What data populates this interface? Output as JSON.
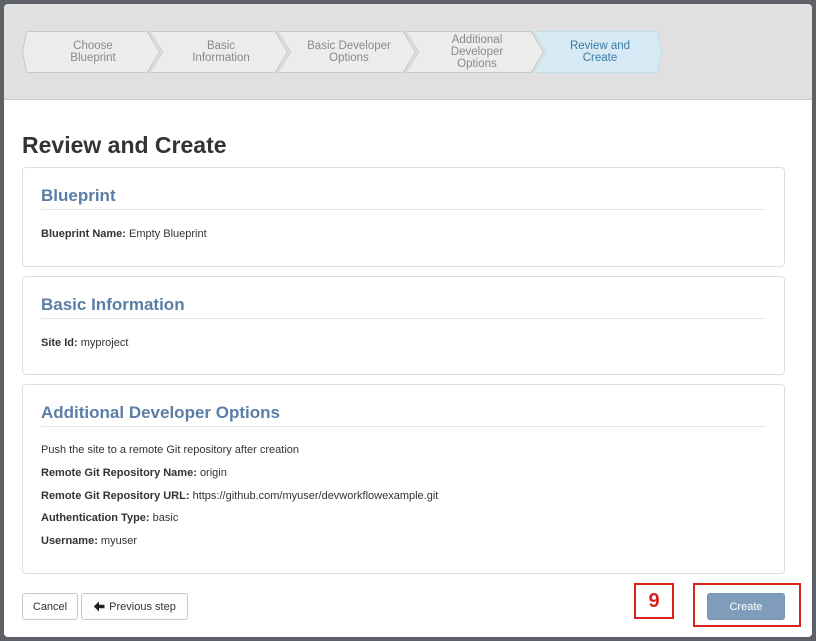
{
  "wizard": {
    "steps": [
      {
        "line1": "Choose",
        "line2": "Blueprint",
        "line3": ""
      },
      {
        "line1": "Basic",
        "line2": "Information",
        "line3": ""
      },
      {
        "line1": "Basic Developer",
        "line2": "Options",
        "line3": ""
      },
      {
        "line1": "Additional",
        "line2": "Developer",
        "line3": "Options"
      },
      {
        "line1": "Review and",
        "line2": "Create",
        "line3": ""
      }
    ],
    "active_step": 4
  },
  "page": {
    "title": "Review and Create"
  },
  "blueprint": {
    "title": "Blueprint",
    "name_label": "Blueprint Name:",
    "name_value": "Empty Blueprint"
  },
  "basic_info": {
    "title": "Basic Information",
    "site_id_label": "Site Id:",
    "site_id_value": "myproject"
  },
  "additional": {
    "title": "Additional Developer Options",
    "push_text": "Push the site to a remote Git repository after creation",
    "remote_name_label": "Remote Git Repository Name:",
    "remote_name_value": "origin",
    "remote_url_label": "Remote Git Repository URL:",
    "remote_url_value": "https://github.com/myuser/devworkflowexample.git",
    "auth_type_label": "Authentication Type:",
    "auth_type_value": "basic",
    "username_label": "Username:",
    "username_value": "myuser"
  },
  "footer": {
    "cancel_label": "Cancel",
    "previous_label": "Previous step",
    "create_label": "Create"
  },
  "annotation": {
    "callout_number": "9",
    "color": "#d9231d"
  },
  "colors": {
    "accent": "#5b7ea6",
    "create_button": "#7f9dbb",
    "active_step": "#d5eaf5"
  }
}
